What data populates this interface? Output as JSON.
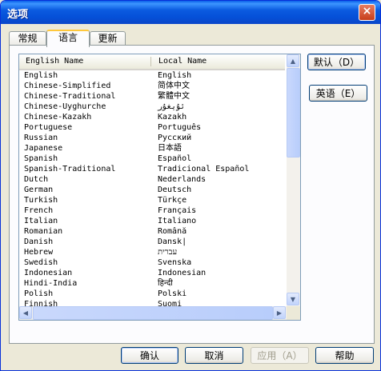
{
  "window": {
    "title": "选项",
    "close_glyph": "×"
  },
  "tabs": [
    {
      "label": "常规"
    },
    {
      "label": "语言"
    },
    {
      "label": "更新"
    }
  ],
  "list": {
    "columns": {
      "english": "English Name",
      "local": "Local Name"
    },
    "rows": [
      [
        "English",
        "English"
      ],
      [
        "Chinese-Simplified",
        "简体中文"
      ],
      [
        "Chinese-Traditional",
        "繁體中文"
      ],
      [
        "Chinese-Uyghurche",
        "ئۇيغۇر"
      ],
      [
        "Chinese-Kazakh",
        "Kazakh"
      ],
      [
        "Portuguese",
        "Português"
      ],
      [
        "Russian",
        "Русский"
      ],
      [
        "Japanese",
        "日本語"
      ],
      [
        "Spanish",
        "Español"
      ],
      [
        "Spanish-Traditional",
        "Tradicional Español"
      ],
      [
        "Dutch",
        "Nederlands"
      ],
      [
        "German",
        "Deutsch"
      ],
      [
        "Turkish",
        "Türkçe"
      ],
      [
        "French",
        "Français"
      ],
      [
        "Italian",
        "Italiano"
      ],
      [
        "Romanian",
        "Română"
      ],
      [
        "Danish",
        "Dansk|"
      ],
      [
        "Hebrew",
        "עברית"
      ],
      [
        "Swedish",
        "Svenska"
      ],
      [
        "Indonesian",
        "Indonesian"
      ],
      [
        "Hindi-India",
        "हिन्दी"
      ],
      [
        "Polish",
        "Polski"
      ],
      [
        "Finnish",
        "Suomi"
      ]
    ]
  },
  "side_buttons": {
    "default": "默认（D）",
    "english": "英语（E）"
  },
  "footer": {
    "ok": "确认",
    "cancel": "取消",
    "apply": "应用（A）",
    "help": "帮助"
  }
}
